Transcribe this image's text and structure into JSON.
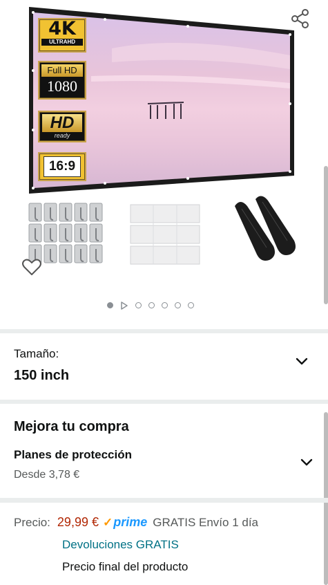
{
  "gallery": {
    "badges": {
      "uhd_big": "4K",
      "uhd_small": "ULTRAHD",
      "fhd_top": "Full HD",
      "fhd_bottom": "1080",
      "hd_top": "HD",
      "hd_bottom": "ready",
      "ratio": "16:9"
    },
    "page_indicator": {
      "total": 7,
      "current": 1
    },
    "icons": {
      "share": "share-icon",
      "favorite": "heart-icon",
      "video": "play-icon"
    }
  },
  "size_selector": {
    "label": "Tamaño:",
    "value": "150 inch"
  },
  "upgrade": {
    "title": "Mejora tu compra",
    "plan_title": "Planes de protección",
    "plan_price": "Desde 3,78 €"
  },
  "price": {
    "label": "Precio:",
    "amount": "29,99 €",
    "prime_check": "✓",
    "prime_word": "prime",
    "shipping": "GRATIS Envío 1 día",
    "returns": "Devoluciones GRATIS",
    "final_note": "Precio final del producto"
  },
  "colors": {
    "price": "#b12704",
    "link": "#007185",
    "prime": "#1a98ff",
    "prime_check": "#ff9900",
    "separator": "#eaeded"
  }
}
